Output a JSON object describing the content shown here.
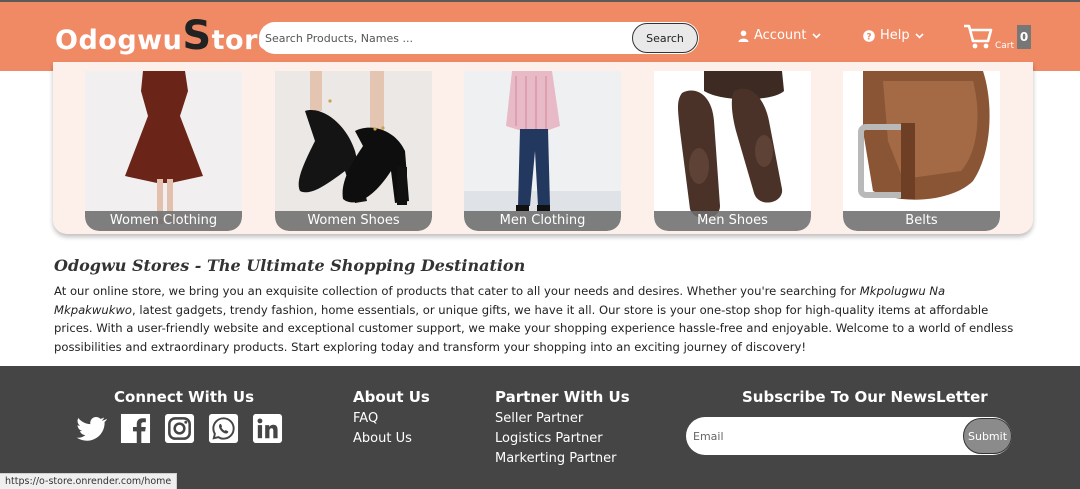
{
  "header": {
    "logo_main": "Odogwu",
    "logo_big_letter": "S",
    "logo_end": "tore",
    "search": {
      "placeholder": "Search Products, Names ...",
      "button_label": "Search"
    },
    "account_label": "Account",
    "help_label": "Help",
    "cart_label": "Cart",
    "cart_count": "0"
  },
  "categories": [
    {
      "label": "Women Clothing",
      "icon": "dress-image"
    },
    {
      "label": "Women Shoes",
      "icon": "heels-image"
    },
    {
      "label": "Men Clothing",
      "icon": "man-image"
    },
    {
      "label": "Men Shoes",
      "icon": "loafers-image"
    },
    {
      "label": "Belts",
      "icon": "belt-image"
    }
  ],
  "intro": {
    "title": "Odogwu Stores - The Ultimate Shopping Destination",
    "text_before": "At our online store, we bring you an exquisite collection of products that cater to all your needs and desires. Whether you're searching for ",
    "text_emphasis": "Mkpolugwu Na Mkpakwukwo",
    "text_after": ", latest gadgets, trendy fashion, home essentials, or unique gifts, we have it all. Our store is your one-stop shop for high-quality items at affordable prices. With a user-friendly website and exceptional customer support, we make your shopping experience hassle-free and enjoyable. Welcome to a world of endless possibilities and extraordinary products. Start exploring today and transform your shopping into an exciting journey of discovery!"
  },
  "footer": {
    "connect_title": "Connect With Us",
    "socials": [
      "twitter-icon",
      "facebook-icon",
      "instagram-icon",
      "whatsapp-icon",
      "linkedin-icon"
    ],
    "about_title": "About Us",
    "about_links": [
      "FAQ",
      "About Us"
    ],
    "partner_title": "Partner With Us",
    "partner_links": [
      "Seller Partner",
      "Logistics Partner",
      "Markerting Partner"
    ],
    "newsletter_title": "Subscribe To Our NewsLetter",
    "newsletter_placeholder": "Email",
    "newsletter_button": "Submit"
  },
  "status_url": "https://o-store.onrender.com/home",
  "colors": {
    "header_bg": "#f08a65",
    "footer_bg": "#454545",
    "strip_bg": "#fdf0ea",
    "label_bg": "#6e6e6e"
  }
}
